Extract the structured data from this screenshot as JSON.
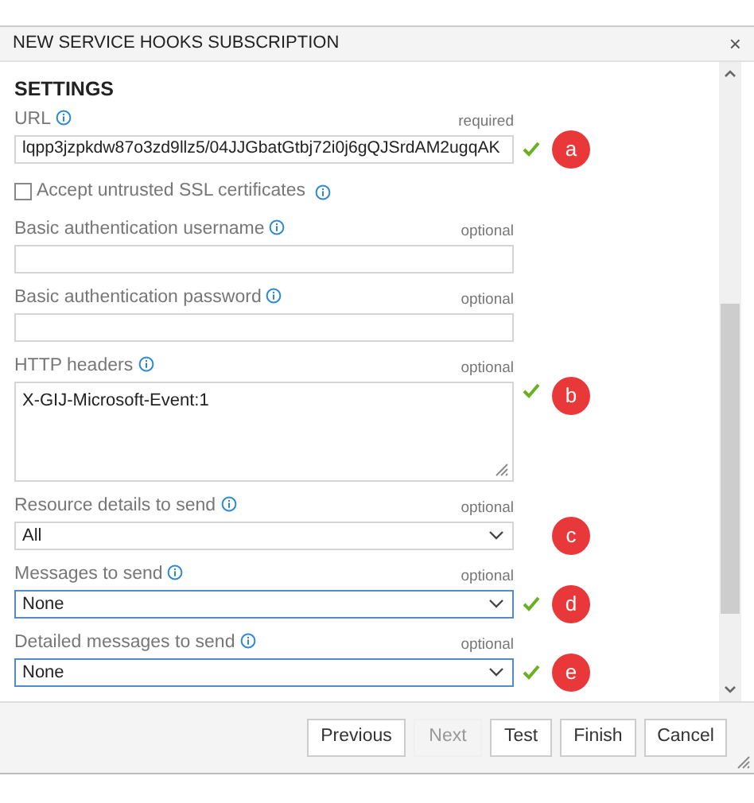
{
  "dialog": {
    "title": "NEW SERVICE HOOKS SUBSCRIPTION",
    "close": "×"
  },
  "section": {
    "title": "SETTINGS"
  },
  "fields": [
    {
      "kind": "text",
      "label": "URL",
      "hint": "required",
      "value": "lqpp3jzpkdw87o3zd9llz5/04JJGbatGtbj72i0j6gQJSrdAM2ugqAK",
      "valid": true,
      "focused": false,
      "marker": "a"
    },
    {
      "kind": "checkbox",
      "label": "Accept untrusted SSL certificates",
      "checked": false
    },
    {
      "kind": "text",
      "label": "Basic authentication username",
      "hint": "optional",
      "valid": false,
      "focused": false
    },
    {
      "kind": "text",
      "label": "Basic authentication password",
      "hint": "optional",
      "valid": false,
      "focused": false
    },
    {
      "kind": "textarea",
      "label": "HTTP headers",
      "hint": "optional",
      "value": "X-GIJ-Microsoft-Event:1",
      "valid": true,
      "focused": false,
      "marker": "b"
    },
    {
      "kind": "select",
      "label": "Resource details to send",
      "hint": "optional",
      "value": "All",
      "valid": false,
      "focused": false,
      "marker": "c"
    },
    {
      "kind": "select",
      "label": "Messages to send",
      "hint": "optional",
      "value": "None",
      "valid": true,
      "focused": true,
      "marker": "d"
    },
    {
      "kind": "select",
      "label": "Detailed messages to send",
      "hint": "optional",
      "value": "None",
      "valid": true,
      "focused": true,
      "marker": "e"
    }
  ],
  "buttons": [
    {
      "label": "Previous",
      "disabled": false
    },
    {
      "label": "Next",
      "disabled": true
    },
    {
      "label": "Test",
      "disabled": false
    },
    {
      "label": "Finish",
      "disabled": false
    },
    {
      "label": "Cancel",
      "disabled": false
    }
  ]
}
